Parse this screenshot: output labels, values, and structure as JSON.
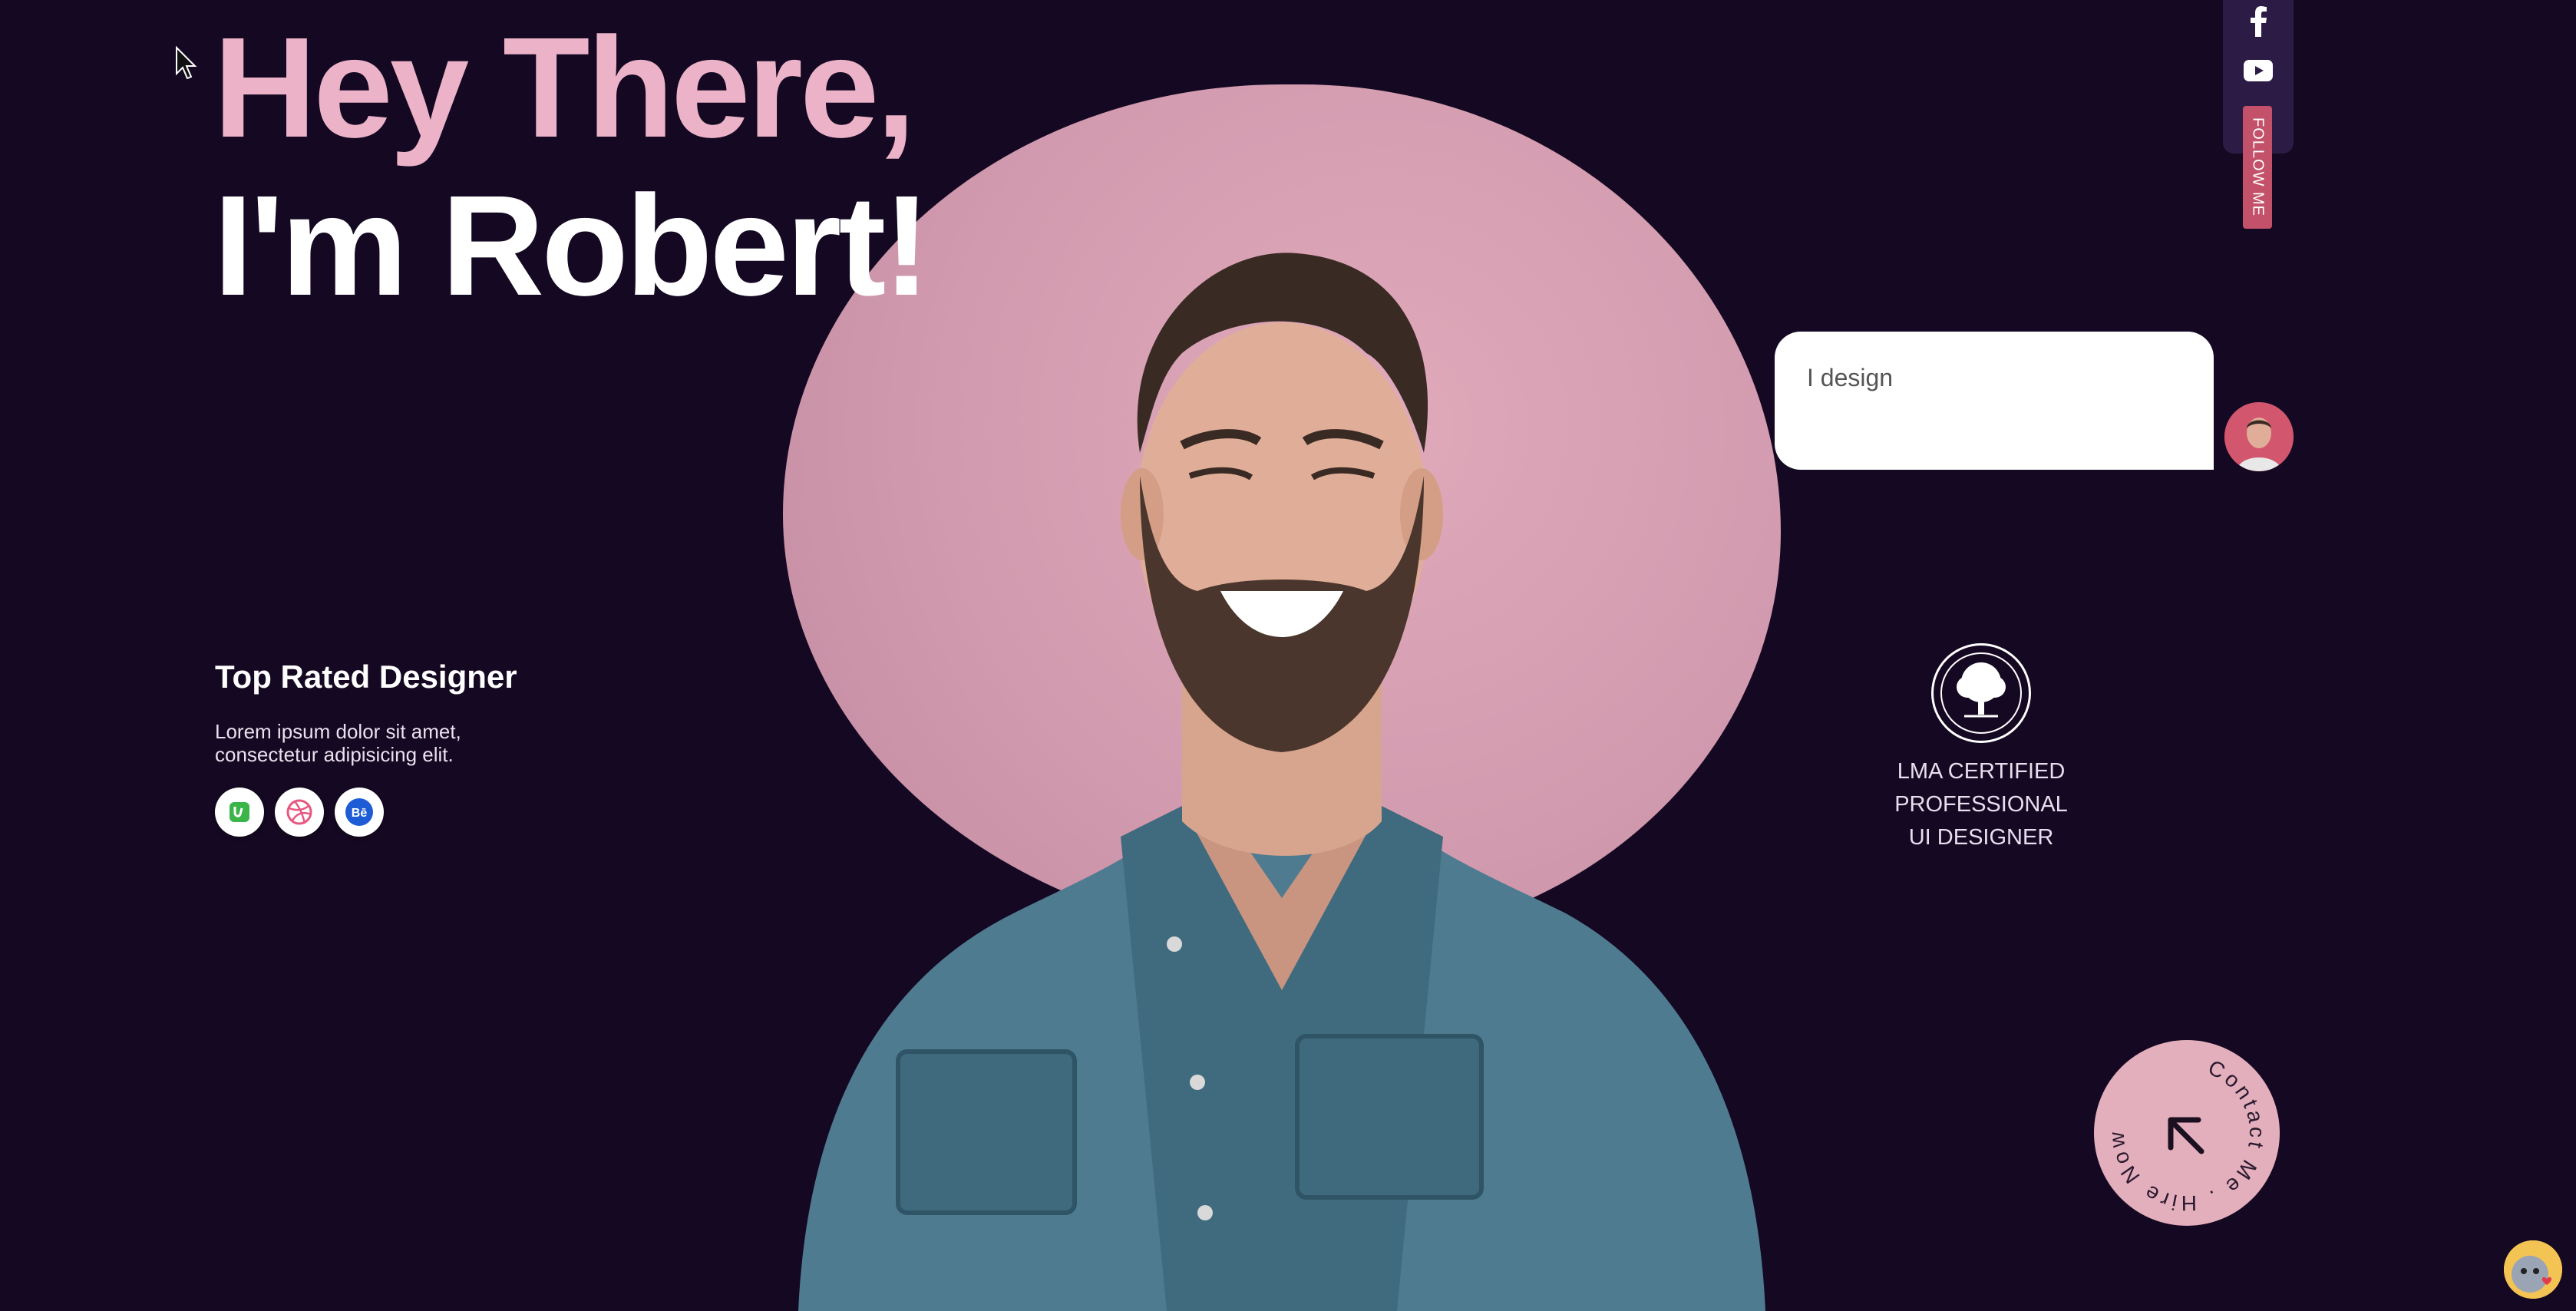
{
  "hero": {
    "greeting": "Hey There,",
    "name_line": "I'm Robert!"
  },
  "intro": {
    "title": "Top Rated Designer",
    "description": "Lorem ipsum dolor sit amet, consectetur adipisicing elit.",
    "badges": [
      {
        "icon": "upwork-icon",
        "color": "#3bb54a"
      },
      {
        "icon": "dribbble-icon",
        "color": "#e8577f"
      },
      {
        "icon": "behance-icon",
        "color": "#1e5cd6"
      }
    ]
  },
  "bubble": {
    "text": "I design"
  },
  "social": {
    "icons": [
      "facebook-icon",
      "youtube-icon"
    ],
    "follow_label": "FOLLOW ME"
  },
  "certification": {
    "line1": "LMA CERTIFIED",
    "line2": "PROFESSIONAL",
    "line3": "UI DESIGNER"
  },
  "contact": {
    "circle_text": "Contact Me . Hire Now .",
    "arrow_icon": "arrow-up-left-icon"
  },
  "colors": {
    "background": "#150822",
    "accent_pink": "#ecb3c8",
    "blob": "#d29aae",
    "follow_tab": "#c3516a"
  }
}
